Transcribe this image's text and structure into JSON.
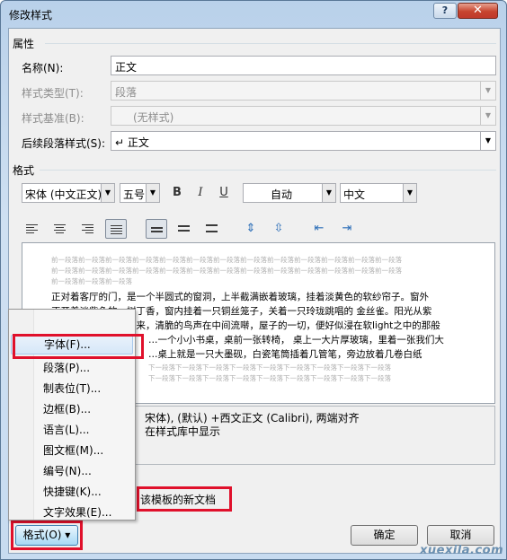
{
  "window": {
    "title": "修改样式",
    "help": "?",
    "close": "✕"
  },
  "properties": {
    "section": "属性",
    "name_label": "名称(N):",
    "name_value": "正文",
    "type_label": "样式类型(T):",
    "type_value": "段落",
    "based_label": "样式基准(B):",
    "based_value": "(无样式)",
    "next_label": "后续段落样式(S):",
    "next_value": "↵ 正文"
  },
  "format": {
    "section": "格式",
    "font": "宋体 (中文正文)",
    "size": "五号",
    "bold": "B",
    "italic": "I",
    "underline": "U",
    "color": "自动",
    "lang": "中文"
  },
  "preview": {
    "prev_lines": [
      "前一段落前一段落前一段落前一段落前一段落前一段落前一段落前一段落前一段落前一段落前一段落前一段落前一段落",
      "前一段落前一段落前一段落前一段落前一段落前一段落前一段落前一段落前一段落前一段落前一段落前一段落前一段落",
      "前一段落前一段落前一段落"
    ],
    "body_lines": [
      "正对着客厅的门，是一个半圆式的窗洞，上半截满嵌着玻璃，挂着淡黄色的软纱帘子。窗外",
      "正开着淡紫色的一树丁香，窗内挂着一只铜丝笼子，关着一只玲珑跳唱的 金丝雀。阳光从紫",
      "云中穿着淡黄纱滤进来，清脆的鸟声在中间流啭，屋子的一切，便好似浸在软light之中的那般",
      "…一个小小书桌，桌前一张转椅， 桌上一大片厚玻璃，里着一张我们大",
      "…桌上就是一只大墨砚，白瓷笔筒插着几管笔，旁边放着几卷白纸"
    ],
    "next_lines": [
      "下一段落下一段落下一段落下一段落下一段落下一段落下一段落下一段落下一段落",
      "下一段落下一段落下一段落下一段落下一段落下一段落下一段落下一段落下一段落"
    ]
  },
  "description": {
    "line1": "宋体), (默认) +西文正文 (Calibri), 两端对齐",
    "line2": "在样式库中显示"
  },
  "template_option": "该模板的新文档",
  "menu": {
    "items": [
      "字体(F)...",
      "段落(P)...",
      "制表位(T)...",
      "边框(B)...",
      "语言(L)...",
      "图文框(M)...",
      "编号(N)...",
      "快捷键(K)...",
      "文字效果(E)..."
    ]
  },
  "buttons": {
    "format": "格式(O) ▾",
    "ok": "确定",
    "cancel": "取消"
  },
  "watermark": "xuexila.com",
  "colors": {
    "highlight": "#e0102b"
  }
}
